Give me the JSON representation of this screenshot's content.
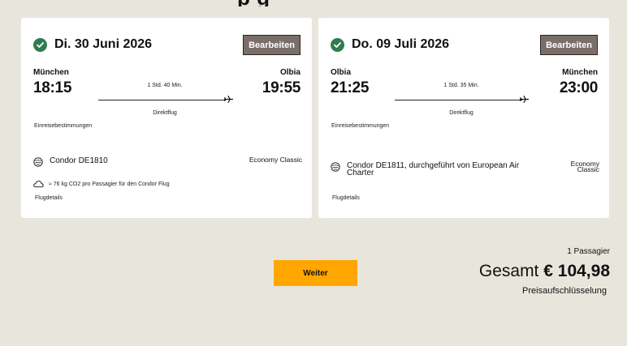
{
  "page": {
    "title_fragment": "p          g"
  },
  "outbound": {
    "date": "Di. 30 Juni 2026",
    "edit_label": "Bearbeiten",
    "origin_city": "München",
    "origin_time": "18:15",
    "destination_city": "Olbia",
    "destination_time": "19:55",
    "duration": "1 Std. 40 Min.",
    "flight_type": "Direktflug",
    "entry_requirements": "Einreisebestimmungen",
    "airline": "Condor DE1810",
    "cabin": "Economy Classic",
    "co2": "≈ 76 kg CO2 pro Passagier für den Condor Flug",
    "details": "Flugdetails"
  },
  "inbound": {
    "date": "Do. 09 Juli 2026",
    "edit_label": "Bearbeiten",
    "origin_city": "Olbia",
    "origin_time": "21:25",
    "destination_city": "München",
    "destination_time": "23:00",
    "duration": "1 Std. 35 Min.",
    "flight_type": "Direktflug",
    "entry_requirements": "Einreisebestimmungen",
    "airline_line1": "Condor DE1811, durchgeführt von European Air",
    "airline_line2": "Charter",
    "cabin_line1": "Economy",
    "cabin_line2": "Classic",
    "details": "Flugdetails"
  },
  "summary": {
    "continue_label": "Weiter",
    "passengers": "1 Passagier",
    "total_label": "Gesamt",
    "total_amount": "€ 104,98",
    "breakdown_link": "Preisaufschlüsselung"
  },
  "colors": {
    "background": "#e8e5dd",
    "check_green": "#2e7d4f",
    "edit_button": "#7a6f68",
    "continue_button": "#ffa600"
  },
  "icons": {
    "check": "check-circle-icon",
    "plane": "plane-icon",
    "airline": "airline-logo-icon",
    "cloud": "cloud-icon"
  }
}
